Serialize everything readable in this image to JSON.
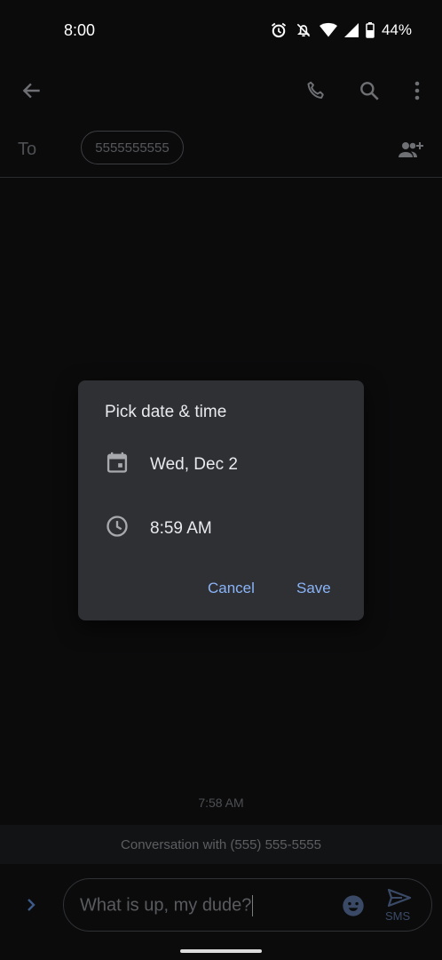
{
  "status_bar": {
    "time": "8:00",
    "battery": "44%",
    "icons": [
      "alarm-icon",
      "notifications-off-icon",
      "wifi-icon",
      "cell-signal-icon",
      "battery-icon"
    ]
  },
  "app_bar": {
    "icons": [
      "back-arrow-icon",
      "phone-icon",
      "search-icon",
      "more-vert-icon"
    ]
  },
  "recipient": {
    "to_label": "To",
    "chip": "5555555555",
    "add_icon": "add-person-icon"
  },
  "dialog": {
    "title": "Pick date & time",
    "date": "Wed, Dec 2",
    "time": "8:59 AM",
    "cancel": "Cancel",
    "save": "Save"
  },
  "conversation": {
    "timestamp": "7:58 AM",
    "banner": "Conversation with (555) 555-5555"
  },
  "compose": {
    "text": "What is up, my dude?",
    "send_label": "SMS"
  },
  "colors": {
    "background": "#0b0b0c",
    "dialog": "#2f3033",
    "accent": "#8ab4f8"
  }
}
